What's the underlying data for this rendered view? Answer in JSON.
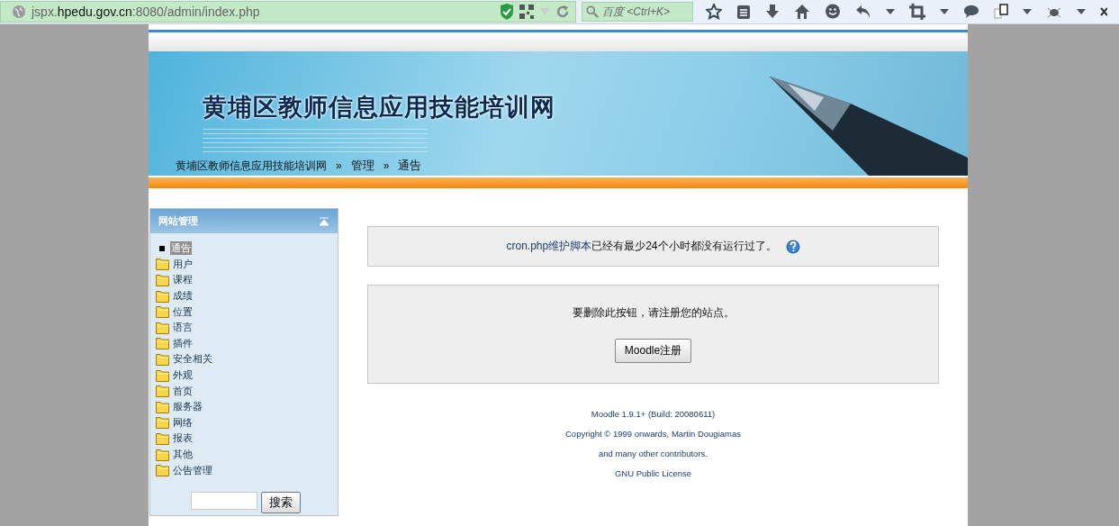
{
  "browser": {
    "url_parts": [
      {
        "text": "jspx.",
        "strong": false
      },
      {
        "text": "hpedu.gov.cn",
        "strong": true
      },
      {
        "text": ":8080/admin/index.php",
        "strong": false
      }
    ],
    "search_placeholder": "百度 <Ctrl+K>"
  },
  "banner": {
    "title": "黄埔区教师信息应用技能培训网"
  },
  "breadcrumb": [
    "黄埔区教师信息应用技能培训网",
    "管理",
    "通告"
  ],
  "breadcrumb_separator": "»",
  "sidebar": {
    "title": "网站管理",
    "items": [
      {
        "label": "通告",
        "kind": "current",
        "selected": true
      },
      {
        "label": "用户",
        "kind": "folder",
        "selected": false
      },
      {
        "label": "课程",
        "kind": "folder",
        "selected": false
      },
      {
        "label": "成绩",
        "kind": "folder",
        "selected": false
      },
      {
        "label": "位置",
        "kind": "folder",
        "selected": false
      },
      {
        "label": "语言",
        "kind": "folder",
        "selected": false
      },
      {
        "label": "插件",
        "kind": "folder",
        "selected": false
      },
      {
        "label": "安全相关",
        "kind": "folder",
        "selected": false
      },
      {
        "label": "外观",
        "kind": "folder",
        "selected": false
      },
      {
        "label": "首页",
        "kind": "folder",
        "selected": false
      },
      {
        "label": "服务器",
        "kind": "folder",
        "selected": false
      },
      {
        "label": "网络",
        "kind": "folder",
        "selected": false
      },
      {
        "label": "报表",
        "kind": "folder",
        "selected": false
      },
      {
        "label": "其他",
        "kind": "folder",
        "selected": false
      },
      {
        "label": "公告管理",
        "kind": "folder",
        "selected": false
      }
    ],
    "search_button": "搜索"
  },
  "notice": {
    "link": "cron.php维护脚本",
    "text": "已经有最少24个小时都没有运行过了。"
  },
  "register": {
    "message": "要删除此按钮，请注册您的站点。",
    "button": "Moodle注册"
  },
  "footer": [
    "Moodle 1.9.1+ (Build: 20080611)",
    "Copyright © 1999 onwards, Martin Dougiamas",
    "and many other contributors.",
    "GNU Public License"
  ]
}
